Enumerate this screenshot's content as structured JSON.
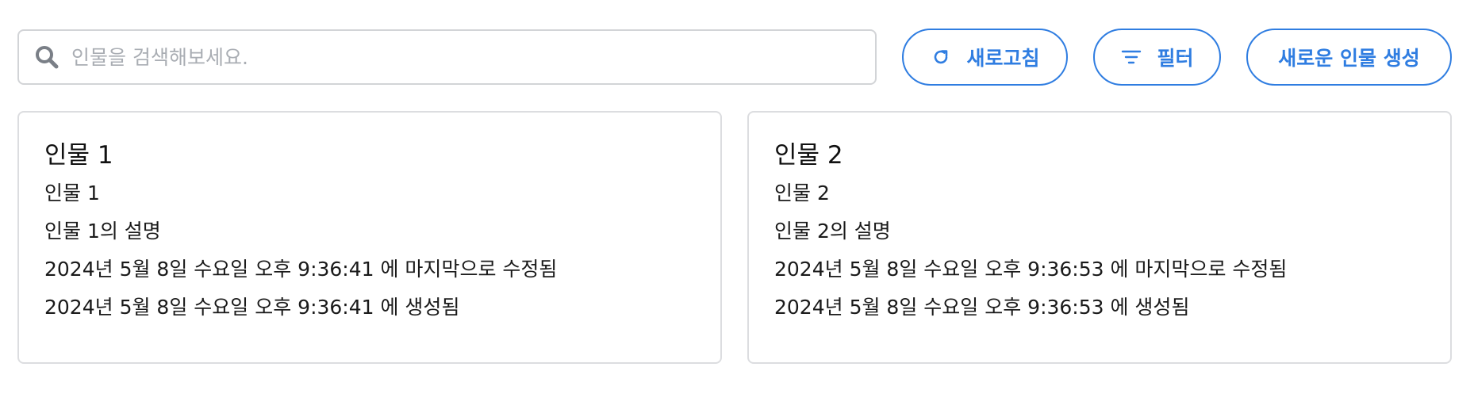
{
  "search": {
    "placeholder": "인물을 검색해보세요.",
    "value": "",
    "icon": "search-icon"
  },
  "toolbar": {
    "refresh_label": "새로고침",
    "refresh_icon": "refresh-icon",
    "filter_label": "필터",
    "filter_icon": "filter-icon",
    "create_label": "새로운 인물 생성"
  },
  "colors": {
    "accent": "#2f7de1",
    "border": "#d2d4d7",
    "placeholder": "#a9adb3",
    "icon_gray": "#7a7f87"
  },
  "cards": [
    {
      "title": "인물 1",
      "name": "인물 1",
      "description": "인물 1의 설명",
      "modified": "2024년 5월 8일 수요일 오후 9:36:41 에 마지막으로 수정됨",
      "created": "2024년 5월 8일 수요일 오후 9:36:41 에 생성됨"
    },
    {
      "title": "인물 2",
      "name": "인물 2",
      "description": "인물 2의 설명",
      "modified": "2024년 5월 8일 수요일 오후 9:36:53 에 마지막으로 수정됨",
      "created": "2024년 5월 8일 수요일 오후 9:36:53 에 생성됨"
    }
  ]
}
